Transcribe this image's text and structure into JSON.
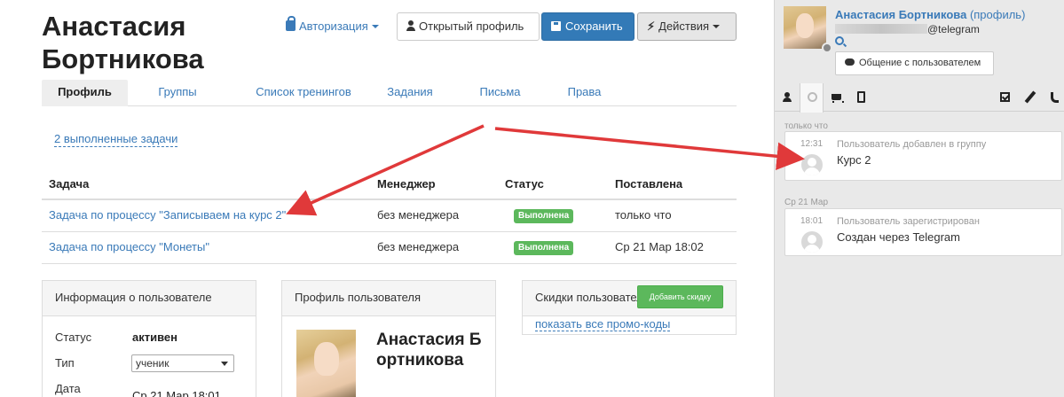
{
  "user": {
    "name": "Анастасия Бортникова"
  },
  "toolbar": {
    "auth_label": "Авторизация",
    "open_profile_label": "Открытый профиль",
    "save_label": "Сохранить",
    "actions_label": "Действия"
  },
  "tabs": [
    {
      "label": "Профиль",
      "active": true
    },
    {
      "label": "Группы",
      "active": false
    },
    {
      "label": "Список тренингов",
      "active": false
    },
    {
      "label": "Задания",
      "active": false
    },
    {
      "label": "Письма",
      "active": false
    },
    {
      "label": "Права",
      "active": false
    }
  ],
  "done_tasks_link": "2 выполненные задачи",
  "tasks_table": {
    "headers": [
      "Задача",
      "Менеджер",
      "Статус",
      "Поставлена"
    ],
    "rows": [
      {
        "task": "Задача по процессу \"Записываем на курс 2\"",
        "manager": "без менеджера",
        "status": "Выполнена",
        "created": "только что"
      },
      {
        "task": "Задача по процессу \"Монеты\"",
        "manager": "без менеджера",
        "status": "Выполнена",
        "created": "Ср 21 Мар 18:02"
      }
    ]
  },
  "info_panel": {
    "title": "Информация о пользователе",
    "status_label": "Статус",
    "status_value": "активен",
    "type_label": "Тип",
    "type_value": "ученик",
    "date_label": "Дата",
    "date_value": "Ср 21 Мар 18:01"
  },
  "profile_panel": {
    "title": "Профиль пользователя",
    "name": "Анастасия Бортникова"
  },
  "discounts_panel": {
    "title": "Скидки пользователя",
    "add_button": "Добавить скидку",
    "promo_link": "показать все промо-коды"
  },
  "sidebar": {
    "name": "Анастасия Бортникова",
    "name_suffix": "(профиль)",
    "email_suffix": "@telegram",
    "chat_button": "Общение с пользователем",
    "groups": [
      {
        "label": "только что",
        "events": [
          {
            "time": "12:31",
            "title": "Пользователь добавлен в группу",
            "text": "Курс 2"
          }
        ]
      },
      {
        "label": "Ср 21 Мар",
        "events": [
          {
            "time": "18:01",
            "title": "Пользователь зарегистрирован",
            "text": "Создан через Telegram"
          }
        ]
      }
    ]
  },
  "colors": {
    "link": "#3a7ab8",
    "primary": "#337ab7",
    "success": "#5cb85c",
    "arrow": "#e0393a",
    "sidebar_bg": "#e9e9e9"
  },
  "icons": {
    "sidebar_tabs": [
      "person-icon",
      "history-icon",
      "cart-icon",
      "tablet-icon",
      "checkbox-icon",
      "pencil-icon",
      "phone-icon"
    ]
  }
}
